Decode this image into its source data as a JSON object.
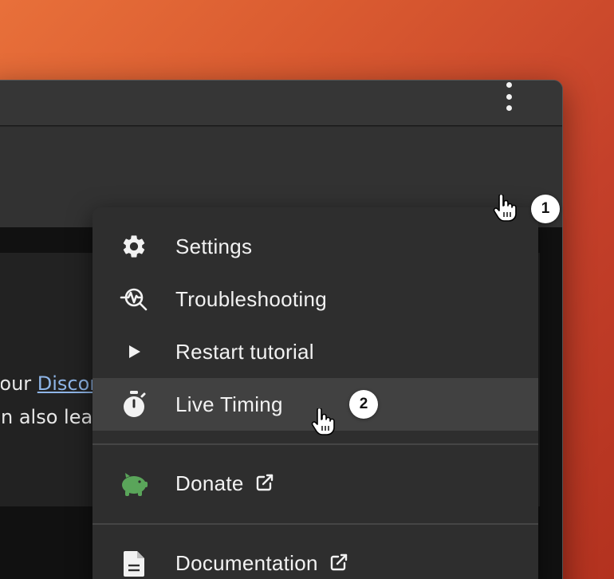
{
  "content": {
    "line1_prefix": "our ",
    "line1_link": "Discord",
    "line2": "n also learn"
  },
  "menu": {
    "items": [
      {
        "label": "Settings",
        "icon": "gear-icon"
      },
      {
        "label": "Troubleshooting",
        "icon": "troubleshoot-icon"
      },
      {
        "label": "Restart tutorial",
        "icon": "play-icon"
      },
      {
        "label": "Live Timing",
        "icon": "stopwatch-icon",
        "highlighted": true
      },
      {
        "label": "Donate",
        "icon": "piggy-bank-icon",
        "external": true
      },
      {
        "label": "Documentation",
        "icon": "document-icon",
        "external": true
      }
    ]
  },
  "annotations": {
    "step1": "1",
    "step2": "2"
  },
  "colors": {
    "background_gradient": [
      "#e8703a",
      "#b3321f"
    ],
    "menu_bg": "#2e2e2e",
    "highlight_bg": "#414141",
    "donate_icon": "#5aa55a",
    "link": "#8fb6e8"
  }
}
